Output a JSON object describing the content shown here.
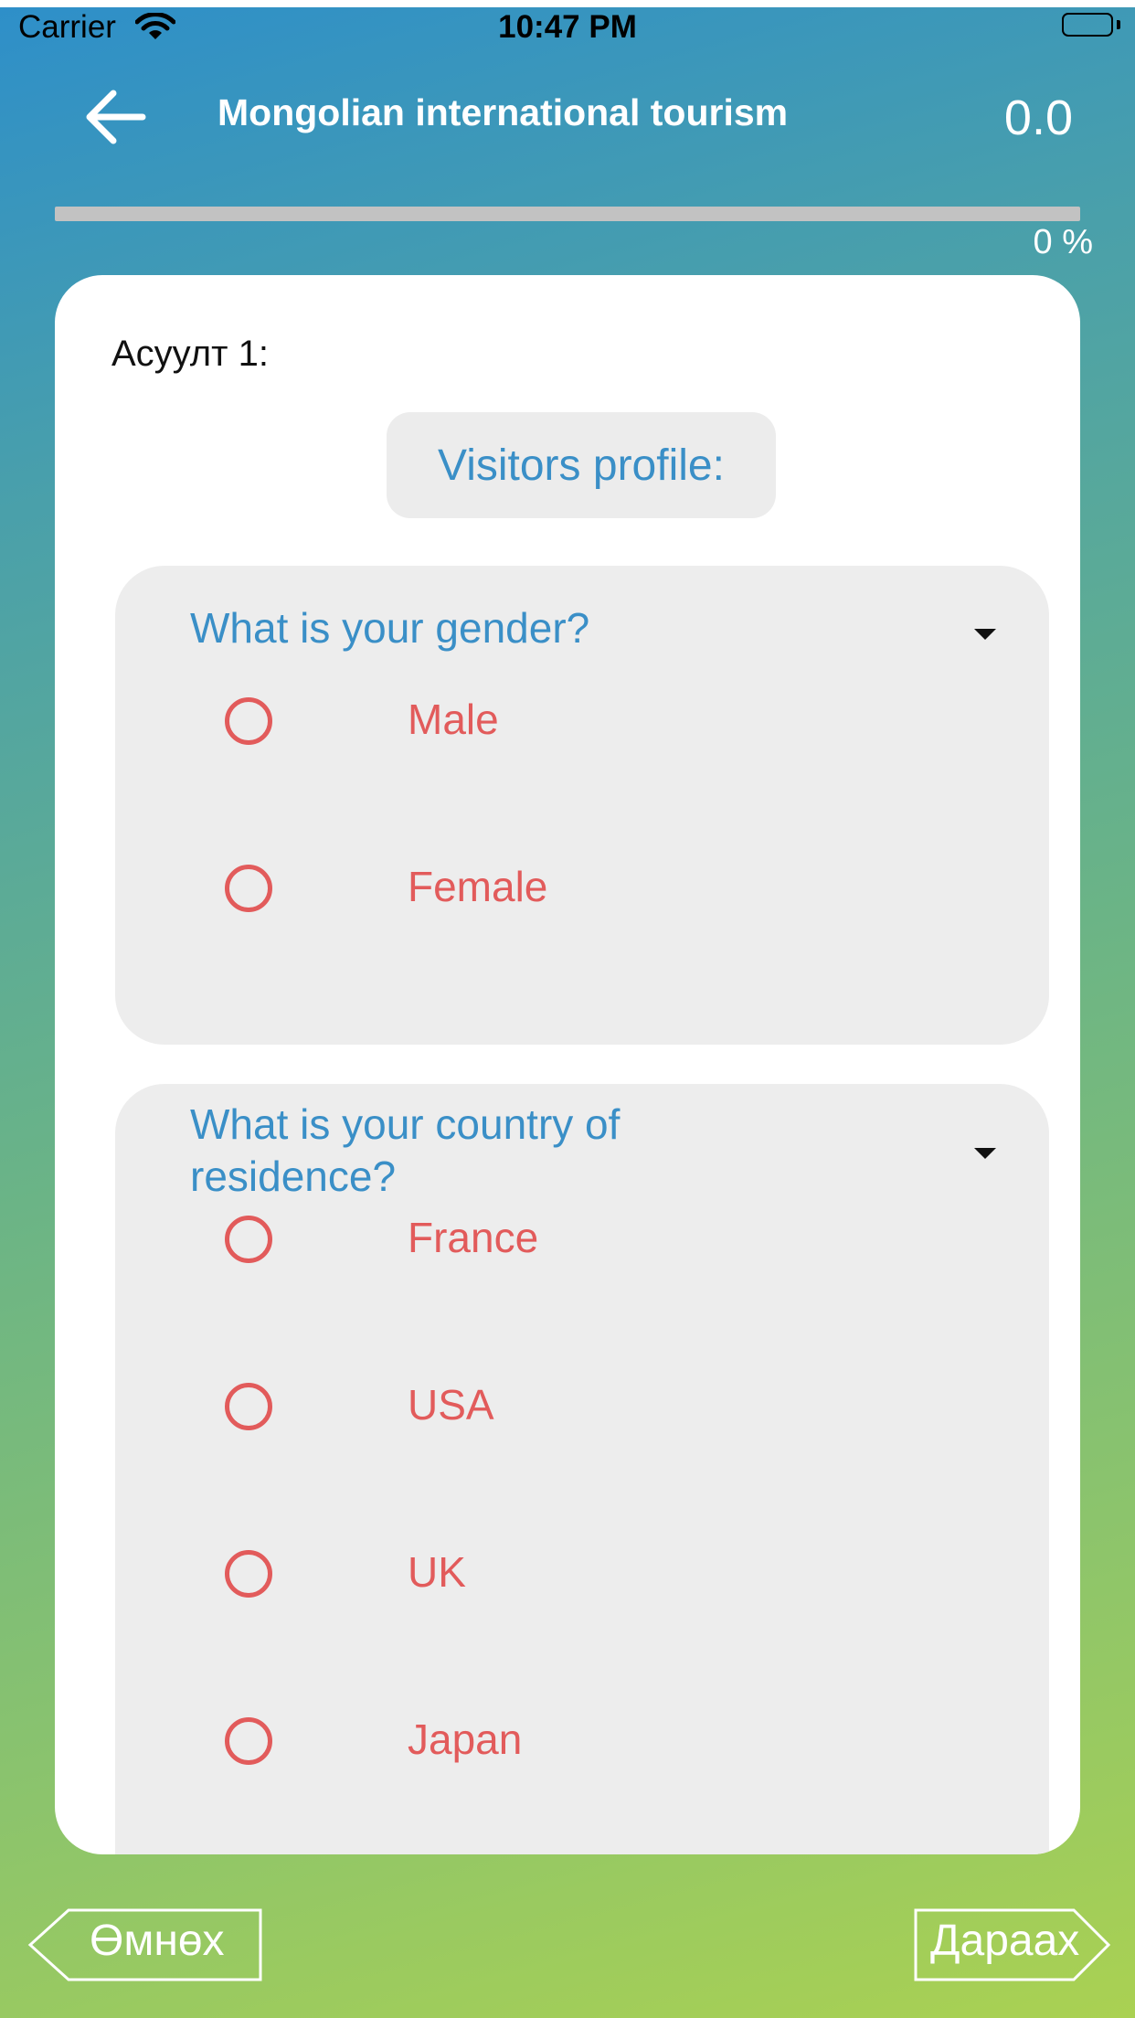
{
  "status_bar": {
    "carrier": "Carrier",
    "time": "10:47 PM"
  },
  "header": {
    "title": "Mongolian international tourism",
    "score": "0.0"
  },
  "progress": {
    "value": 0,
    "label": "0 %"
  },
  "question": {
    "number_label": "Асуулт 1:",
    "section": "Visitors profile:",
    "groups": [
      {
        "prompt": "What is your gender?",
        "options": [
          "Male",
          "Female"
        ]
      },
      {
        "prompt": "What is your country of residence?",
        "options": [
          "France",
          "USA",
          "UK",
          "Japan"
        ]
      }
    ]
  },
  "footer": {
    "prev_label": "Өмнөх",
    "next_label": "Дараах"
  },
  "colors": {
    "accent": "#3a8fc7",
    "option": "#e25b5b",
    "panel": "#ededed",
    "gradient_top": "#2e8fc9",
    "gradient_bottom": "#aad152"
  },
  "icons": {
    "back": "arrow-left-icon",
    "expand": "caret-down-icon",
    "wifi": "wifi-icon",
    "battery": "battery-icon"
  }
}
